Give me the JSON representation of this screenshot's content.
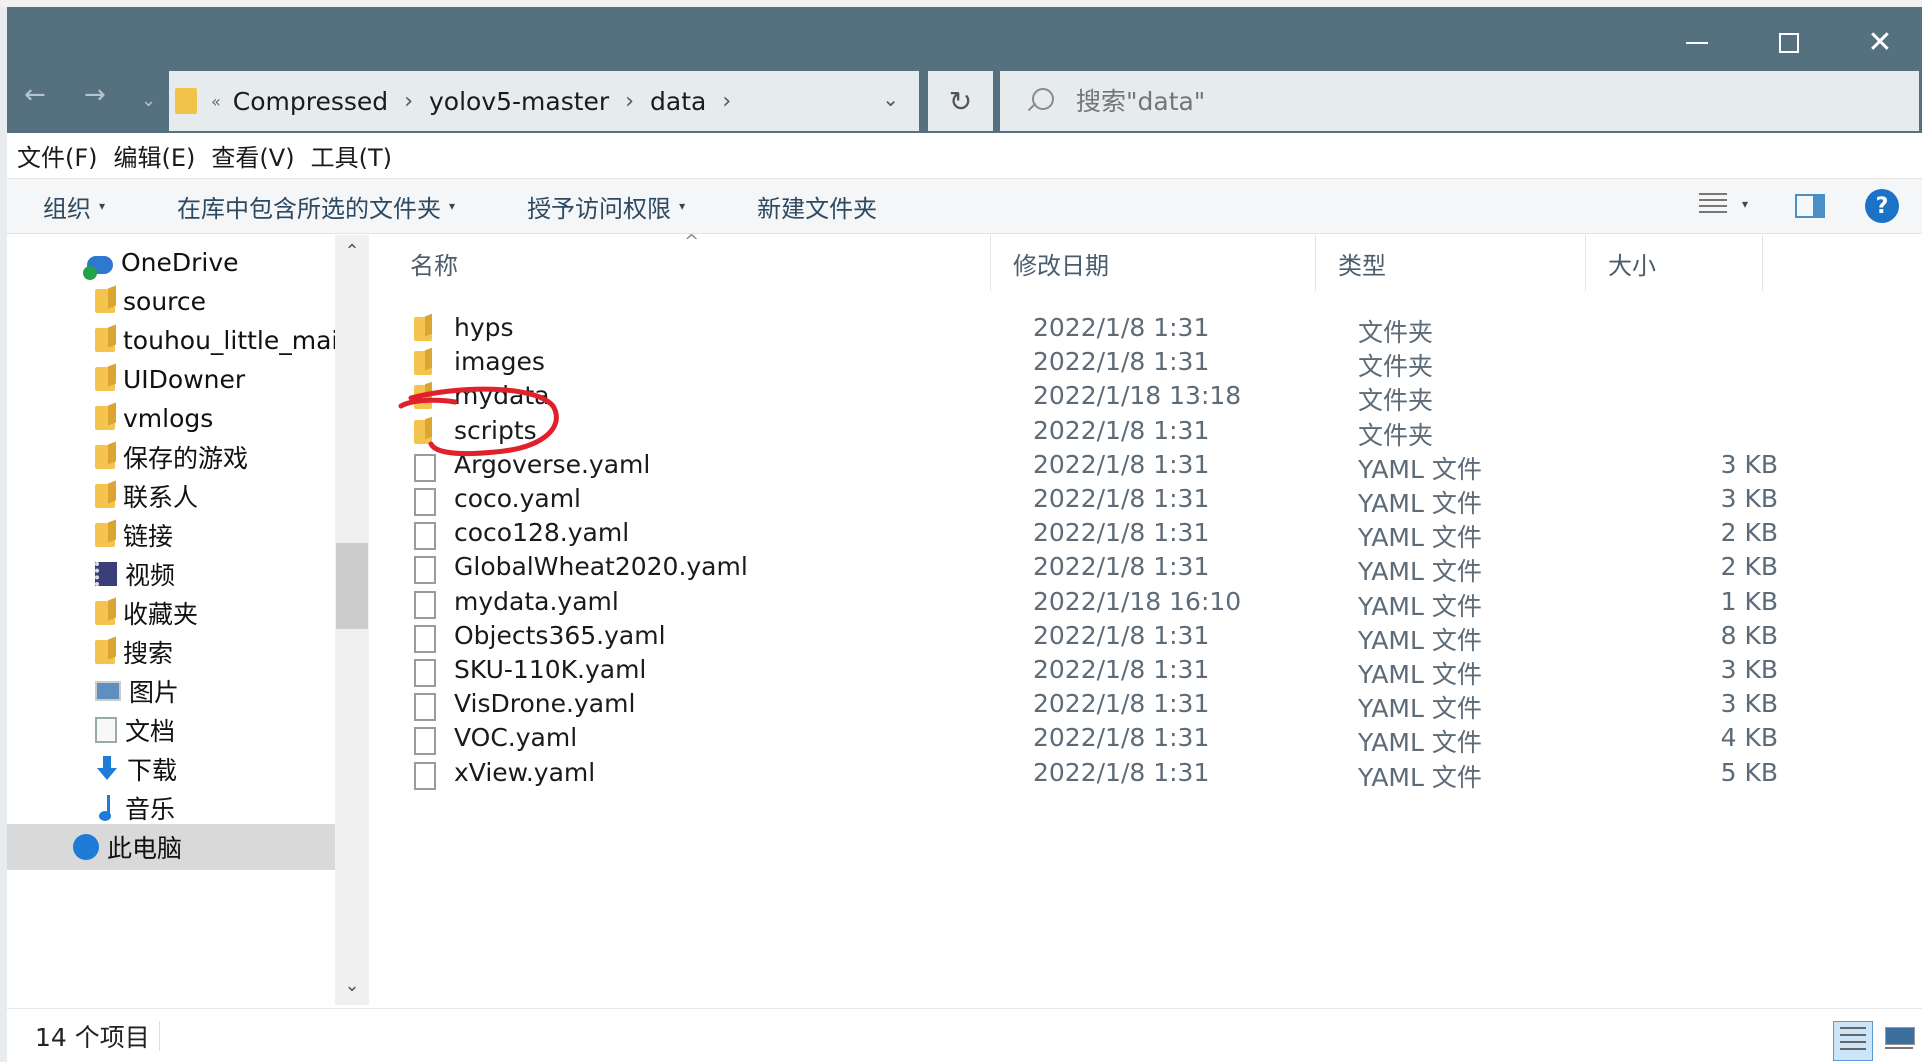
{
  "window": {
    "controls": {
      "minimize": "minimize",
      "maximize": "maximize",
      "close": "close"
    }
  },
  "address": {
    "overflow": "«",
    "crumbs": [
      "Compressed",
      "yolov5-master",
      "data"
    ]
  },
  "search": {
    "placeholder": "搜索\"data\""
  },
  "menu": [
    "文件(F)",
    "编辑(E)",
    "查看(V)",
    "工具(T)"
  ],
  "commands": [
    {
      "label": "组织",
      "dropdown": true
    },
    {
      "label": "在库中包含所选的文件夹",
      "dropdown": true
    },
    {
      "label": "授予访问权限",
      "dropdown": true
    },
    {
      "label": "新建文件夹",
      "dropdown": false
    }
  ],
  "nav": [
    {
      "label": "OneDrive",
      "icon": "onedrive-icon",
      "selected": false
    },
    {
      "label": "source",
      "icon": "folder-icon",
      "selected": false
    },
    {
      "label": "touhou_little_maid",
      "icon": "folder-icon",
      "selected": false
    },
    {
      "label": "UIDowner",
      "icon": "folder-icon",
      "selected": false
    },
    {
      "label": "vmlogs",
      "icon": "folder-icon",
      "selected": false
    },
    {
      "label": "保存的游戏",
      "icon": "saved-games-icon",
      "selected": false
    },
    {
      "label": "联系人",
      "icon": "contacts-icon",
      "selected": false
    },
    {
      "label": "链接",
      "icon": "links-icon",
      "selected": false
    },
    {
      "label": "视频",
      "icon": "video-icon",
      "selected": false
    },
    {
      "label": "收藏夹",
      "icon": "favorites-icon",
      "selected": false
    },
    {
      "label": "搜索",
      "icon": "search-folder-icon",
      "selected": false
    },
    {
      "label": "图片",
      "icon": "pictures-icon",
      "selected": false
    },
    {
      "label": "文档",
      "icon": "documents-icon",
      "selected": false
    },
    {
      "label": "下载",
      "icon": "downloads-icon",
      "selected": false
    },
    {
      "label": "音乐",
      "icon": "music-icon",
      "selected": false
    },
    {
      "label": "此电脑",
      "icon": "this-pc-icon",
      "selected": true
    }
  ],
  "columns": {
    "name": "名称",
    "date": "修改日期",
    "type": "类型",
    "size": "大小"
  },
  "files": [
    {
      "name": "hyps",
      "date": "2022/1/8 1:31",
      "type": "文件夹",
      "size": "",
      "kind": "folder"
    },
    {
      "name": "images",
      "date": "2022/1/8 1:31",
      "type": "文件夹",
      "size": "",
      "kind": "folder"
    },
    {
      "name": "mydata",
      "date": "2022/1/18 13:18",
      "type": "文件夹",
      "size": "",
      "kind": "folder"
    },
    {
      "name": "scripts",
      "date": "2022/1/8 1:31",
      "type": "文件夹",
      "size": "",
      "kind": "folder"
    },
    {
      "name": "Argoverse.yaml",
      "date": "2022/1/8 1:31",
      "type": "YAML 文件",
      "size": "3 KB",
      "kind": "file"
    },
    {
      "name": "coco.yaml",
      "date": "2022/1/8 1:31",
      "type": "YAML 文件",
      "size": "3 KB",
      "kind": "file"
    },
    {
      "name": "coco128.yaml",
      "date": "2022/1/8 1:31",
      "type": "YAML 文件",
      "size": "2 KB",
      "kind": "file"
    },
    {
      "name": "GlobalWheat2020.yaml",
      "date": "2022/1/8 1:31",
      "type": "YAML 文件",
      "size": "2 KB",
      "kind": "file"
    },
    {
      "name": "mydata.yaml",
      "date": "2022/1/18 16:10",
      "type": "YAML 文件",
      "size": "1 KB",
      "kind": "file"
    },
    {
      "name": "Objects365.yaml",
      "date": "2022/1/8 1:31",
      "type": "YAML 文件",
      "size": "8 KB",
      "kind": "file"
    },
    {
      "name": "SKU-110K.yaml",
      "date": "2022/1/8 1:31",
      "type": "YAML 文件",
      "size": "3 KB",
      "kind": "file"
    },
    {
      "name": "VisDrone.yaml",
      "date": "2022/1/8 1:31",
      "type": "YAML 文件",
      "size": "3 KB",
      "kind": "file"
    },
    {
      "name": "VOC.yaml",
      "date": "2022/1/8 1:31",
      "type": "YAML 文件",
      "size": "4 KB",
      "kind": "file"
    },
    {
      "name": "xView.yaml",
      "date": "2022/1/8 1:31",
      "type": "YAML 文件",
      "size": "5 KB",
      "kind": "file"
    }
  ],
  "status": {
    "count": "14 个项目"
  },
  "annotation": {
    "color": "#e0202a",
    "target": "mydata"
  },
  "colors": {
    "titlebar": "#557180",
    "accent": "#1a73c6",
    "folder": "#f4c44f"
  }
}
